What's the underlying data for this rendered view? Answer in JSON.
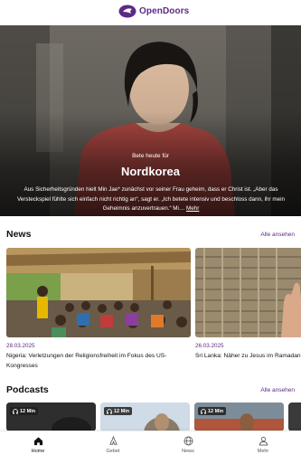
{
  "app": {
    "logo_text": "OpenDoors"
  },
  "hero": {
    "kicker": "Bete heute für",
    "title": "Nordkorea",
    "text": "Aus Sicherheitsgründen hielt Min Jae* zunächst vor seiner Frau geheim, dass er Christ ist. „Aber das Versteckspiel fühlte sich einfach nicht richtig an“, sagt er. „Ich betete intensiv und beschloss dann, ihr mein Geheimnis anzuvertrauen.“ Mi…",
    "more": "Mehr"
  },
  "news": {
    "title": "News",
    "see_all": "Alle ansehen",
    "items": [
      {
        "date": "28.03.2025",
        "title": "Nigeria: Verletzungen der Religionsfreiheit im Fokus des US-Kongresses"
      },
      {
        "date": "26.03.2025",
        "title": "Sri Lanka: Näher zu Jesus im Ramadan"
      }
    ]
  },
  "podcasts": {
    "title": "Podcasts",
    "see_all": "Alle ansehen",
    "items": [
      {
        "duration": "12 Min"
      },
      {
        "duration": "12 Min"
      },
      {
        "duration": "12 Min"
      },
      {
        "duration": ""
      }
    ]
  },
  "nav": {
    "items": [
      {
        "label": "Home",
        "icon": "home-icon",
        "active": true
      },
      {
        "label": "Gebet",
        "icon": "prayer-icon",
        "active": false
      },
      {
        "label": "News",
        "icon": "globe-icon",
        "active": false
      },
      {
        "label": "Mehr",
        "icon": "user-icon",
        "active": false
      }
    ]
  },
  "colors": {
    "brand": "#5b2a86"
  }
}
